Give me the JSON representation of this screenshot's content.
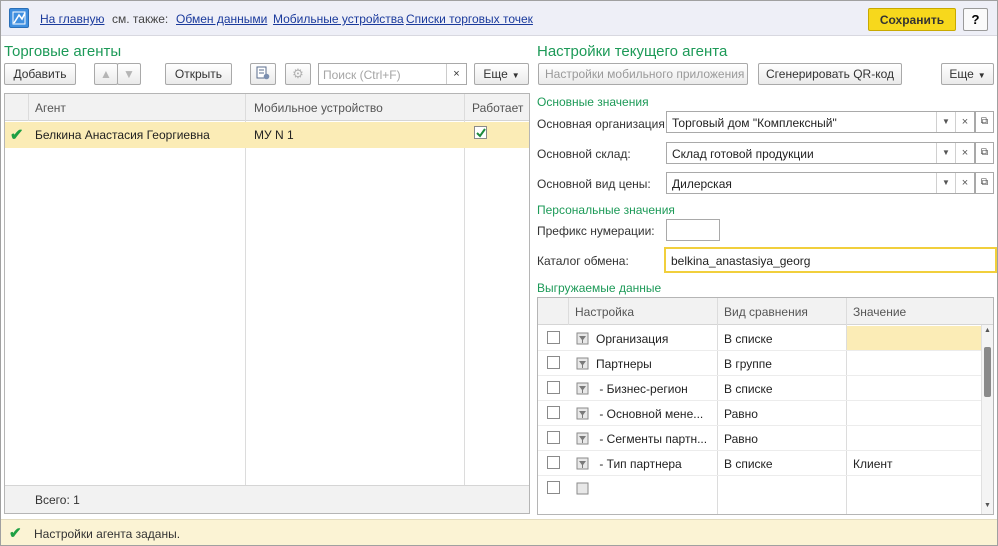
{
  "topbar": {
    "home_link": "На главную",
    "see_also": "см. также:",
    "links": [
      "Обмен данными",
      "Мобильные устройства",
      "Списки торговых точек"
    ],
    "save_label": "Сохранить",
    "help_label": "?"
  },
  "left": {
    "title": "Торговые агенты",
    "add_label": "Добавить",
    "open_label": "Открыть",
    "search_placeholder": "Поиск (Ctrl+F)",
    "search_clear": "×",
    "more_label": "Еще",
    "columns": [
      "Агент",
      "Мобильное устройство",
      "Работает"
    ],
    "rows": [
      {
        "agent": "Белкина Анастасия Георгиевна",
        "device": "МУ N 1",
        "works": true
      }
    ],
    "footer": "Всего: 1"
  },
  "right": {
    "title": "Настройки текущего агента",
    "mobile_settings_label": "Настройки мобильного приложения",
    "qr_label": "Сгенерировать QR-код",
    "more_label": "Еще",
    "basic_section": "Основные значения",
    "org_label": "Основная организация:",
    "org_value": "Торговый дом \"Комплексный\"",
    "warehouse_label": "Основной склад:",
    "warehouse_value": "Склад готовой продукции",
    "price_label": "Основной вид цены:",
    "price_value": "Дилерская",
    "personal_section": "Персональные значения",
    "prefix_label": "Префикс нумерации:",
    "prefix_value": "",
    "catalog_label": "Каталог обмена:",
    "catalog_value": "belkina_anastasiya_georg",
    "export_section": "Выгружаемые данные",
    "columns": [
      "Настройка",
      "Вид сравнения",
      "Значение"
    ],
    "rows": [
      {
        "name": "Организация",
        "cmp": "В списке",
        "value": ""
      },
      {
        "name": "Партнеры",
        "cmp": "В группе",
        "value": ""
      },
      {
        "name": " - Бизнес-регион",
        "cmp": "В списке",
        "value": ""
      },
      {
        "name": " - Основной мене...",
        "cmp": "Равно",
        "value": ""
      },
      {
        "name": " - Сегменты партн...",
        "cmp": "Равно",
        "value": ""
      },
      {
        "name": " - Тип партнера",
        "cmp": "В списке",
        "value": "Клиент"
      }
    ]
  },
  "status": {
    "text": "Настройки агента заданы."
  },
  "colors": {
    "accent_green": "#1d9a58",
    "selected_row": "#fbecb6",
    "save_button": "#f7d81c",
    "link": "#1a3a9c"
  }
}
